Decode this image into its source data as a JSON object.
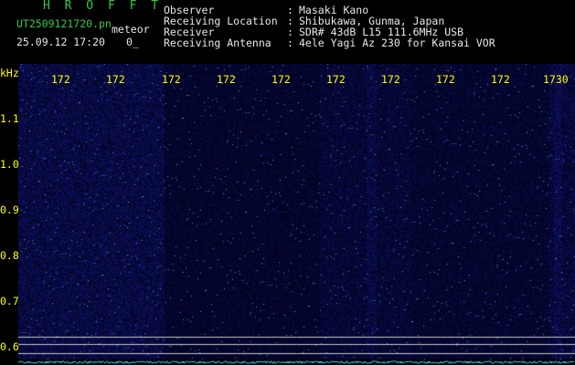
{
  "header": {
    "app_title": "H R O F F T",
    "filename": "UT2509121720.pn",
    "meteor_label": "meteor",
    "timestamp": "25.09.12 17:20",
    "count": "0_"
  },
  "info": [
    {
      "label": "Observer",
      "value": "Masaki Kano"
    },
    {
      "label": "Receiving Location",
      "value": "Shibukawa, Gunma, Japan"
    },
    {
      "label": "Receiver",
      "value": "SDR# 43dB L15 111.6MHz USB"
    },
    {
      "label": "Receiving Antenna",
      "value": "4ele Yagi Az 230 for Kansai VOR"
    }
  ],
  "axis": {
    "unit": "kHz",
    "y_ticks": [
      "1.1",
      "1.0",
      "0.9",
      "0.8",
      "0.7",
      "0.6"
    ],
    "x_ticks": [
      "172",
      "172",
      "172",
      "172",
      "172",
      "172",
      "172",
      "172",
      "172",
      "1730"
    ]
  },
  "colors": {
    "background": "#000000",
    "waterfall": "#0a0a5a",
    "signal": "#3fd7ff",
    "text_yellow": "#ffff00",
    "text_green": "#2ecc40",
    "text_white": "#e8e8e8"
  }
}
